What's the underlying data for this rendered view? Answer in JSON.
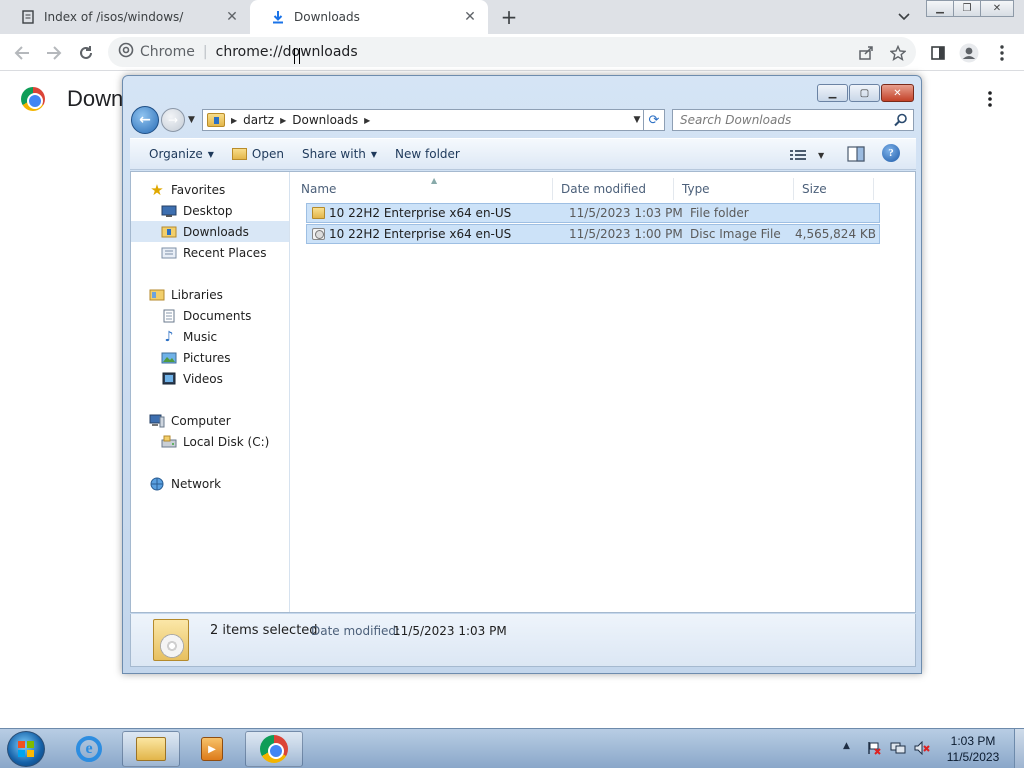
{
  "browser": {
    "tabs": [
      {
        "title": "Index of /isos/windows/",
        "icon": "document-icon",
        "active": false
      },
      {
        "title": "Downloads",
        "icon": "download-icon",
        "active": true
      }
    ],
    "omnibox": {
      "site_label": "Chrome",
      "url": "chrome://downloads"
    },
    "page_heading": "Down"
  },
  "explorer": {
    "breadcrumb": [
      "dartz",
      "Downloads"
    ],
    "search_placeholder": "Search Downloads",
    "commands": {
      "organize": "Organize",
      "open": "Open",
      "share_with": "Share with",
      "new_folder": "New folder"
    },
    "nav": {
      "favorites": "Favorites",
      "favorites_items": [
        "Desktop",
        "Downloads",
        "Recent Places"
      ],
      "libraries": "Libraries",
      "libraries_items": [
        "Documents",
        "Music",
        "Pictures",
        "Videos"
      ],
      "computer": "Computer",
      "computer_items": [
        "Local Disk (C:)"
      ],
      "network": "Network",
      "selected": "Downloads"
    },
    "columns": [
      "Name",
      "Date modified",
      "Type",
      "Size"
    ],
    "files": [
      {
        "name": "10 22H2 Enterprise x64 en-US",
        "date": "11/5/2023 1:03 PM",
        "type": "File folder",
        "size": "",
        "icon": "folder-icon"
      },
      {
        "name": "10 22H2 Enterprise x64 en-US",
        "date": "11/5/2023 1:00 PM",
        "type": "Disc Image File",
        "size": "4,565,824 KB",
        "icon": "disc-image-icon"
      }
    ],
    "details": {
      "selection": "2 items selected",
      "date_label": "Date modified:",
      "date_value": "11/5/2023 1:03 PM"
    }
  },
  "taskbar": {
    "clock_time": "1:03 PM",
    "clock_date": "11/5/2023",
    "apps": [
      "internet-explorer-icon",
      "windows-explorer-icon",
      "media-player-icon",
      "chrome-icon"
    ]
  }
}
